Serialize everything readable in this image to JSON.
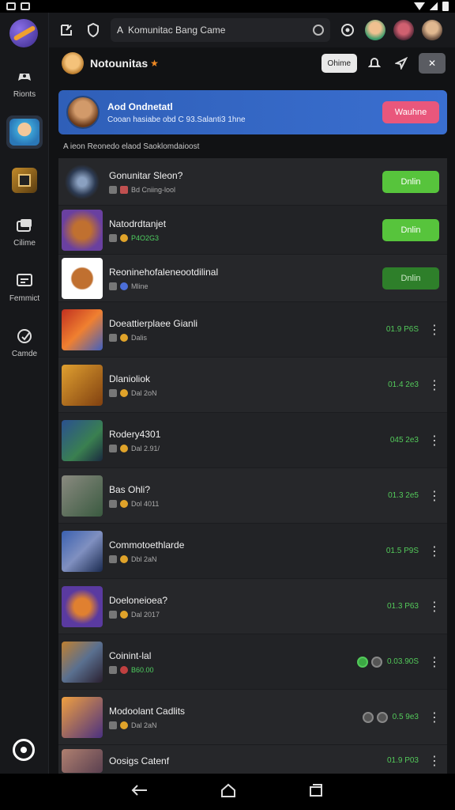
{
  "rail": {
    "items": [
      {
        "label": "Rionts",
        "icon": "controller-icon"
      },
      {
        "label": "",
        "icon": "game-avatar"
      },
      {
        "label": "",
        "icon": "game-panel"
      },
      {
        "label": "Cilime",
        "icon": "folder-icon"
      },
      {
        "label": "Femmict",
        "icon": "chat-icon"
      },
      {
        "label": "Camde",
        "icon": "compass-icon"
      }
    ]
  },
  "topbar": {
    "url": "Komunitac Bang Came",
    "lock": "A"
  },
  "header": {
    "title": "Notounitas",
    "star": "★",
    "online_label": "Ohime",
    "close_label": "✕"
  },
  "banner": {
    "title": "Aod Ondnetatl",
    "subtitle": "Cooan hasiabe obd C 93.Salanti3 1hne",
    "button": "Wauhne"
  },
  "section_label": "A ieon Reonedo elaod Saoklomdaioost",
  "rows": [
    {
      "name": "Gonunitar Sleon?",
      "meta": "Bd Cniing-lool",
      "meta_green": false,
      "action": "Dnlin",
      "dim": false
    },
    {
      "name": "Natodrdtanjet",
      "meta": "P4O2G3",
      "meta_green": true,
      "action": "Dnlin",
      "dim": false
    },
    {
      "name": "Reoninehofaleneootdilinal",
      "meta": "Mline",
      "meta_green": false,
      "action": "Dnlin",
      "dim": true
    },
    {
      "name": "Doeattierplaee Gianli",
      "meta": "Dalis",
      "score": "01.9 P6S"
    },
    {
      "name": "Dlanioliok",
      "meta": "Dal 2oN",
      "score": "01.4 2e3"
    },
    {
      "name": "Rodery4301",
      "meta": "Dal 2.91/",
      "score": "045 2e3"
    },
    {
      "name": "Bas Ohli?",
      "meta": "Dol 4011",
      "score": "01.3 2e5"
    },
    {
      "name": "Commotoethlarde",
      "meta": "Dbl 2aN",
      "score": "01.5 P9S"
    },
    {
      "name": "Doeloneioea?",
      "meta": "Dal 2017",
      "score": "01.3 P63"
    },
    {
      "name": "Coinint-lal",
      "meta": "B60.00",
      "meta_green": true,
      "score": "0.03.90S",
      "toggles": true
    },
    {
      "name": "Modoolant Cadlits",
      "meta": "Dal 2aN",
      "score": "0.5 9e3",
      "toggles": true
    },
    {
      "name": "Oosigs Catenf",
      "meta": "",
      "score": "01.9 P03"
    }
  ],
  "colors": {
    "accent_blue": "#3a6fd0",
    "join_green": "#57c43c",
    "cta_pink": "#e9577c",
    "score_green": "#53c95a"
  }
}
